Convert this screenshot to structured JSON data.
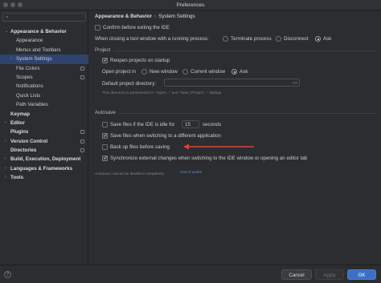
{
  "window": {
    "title": "Preferences"
  },
  "search": {
    "placeholder": "Q"
  },
  "sidebar": {
    "items": [
      {
        "label": "Appearance & Behavior",
        "arrow": "⌄",
        "bold": true,
        "indent": 0
      },
      {
        "label": "Appearance",
        "indent": 1
      },
      {
        "label": "Menus and Toolbars",
        "indent": 1
      },
      {
        "label": "System Settings",
        "arrow": "›",
        "indent": 1,
        "selected": true
      },
      {
        "label": "File Colors",
        "indent": 1,
        "mark": true
      },
      {
        "label": "Scopes",
        "indent": 1,
        "mark": true
      },
      {
        "label": "Notifications",
        "indent": 1
      },
      {
        "label": "Quick Lists",
        "indent": 1
      },
      {
        "label": "Path Variables",
        "indent": 1
      },
      {
        "label": "Keymap",
        "bold": true,
        "indent": 0
      },
      {
        "label": "Editor",
        "arrow": "›",
        "bold": true,
        "indent": 0
      },
      {
        "label": "Plugins",
        "bold": true,
        "indent": 0,
        "mark": true
      },
      {
        "label": "Version Control",
        "arrow": "›",
        "bold": true,
        "indent": 0,
        "mark": true
      },
      {
        "label": "Directories",
        "bold": true,
        "indent": 0,
        "mark": true
      },
      {
        "label": "Build, Execution, Deployment",
        "arrow": "›",
        "bold": true,
        "indent": 0
      },
      {
        "label": "Languages & Frameworks",
        "arrow": "›",
        "bold": true,
        "indent": 0
      },
      {
        "label": "Tools",
        "arrow": "›",
        "bold": true,
        "indent": 0
      }
    ]
  },
  "breadcrumb": {
    "parent": "Appearance & Behavior",
    "sep": "›",
    "page": "System Settings"
  },
  "general": {
    "confirm_exit": "Confirm before exiting the IDE",
    "closing_label": "When closing a tool window with a running process:",
    "closing_options": [
      "Terminate process",
      "Disconnect",
      "Ask"
    ],
    "closing_selected": "Ask"
  },
  "project": {
    "section": "Project",
    "reopen": "Reopen projects on startup",
    "open_label": "Open project in",
    "open_options": [
      "New window",
      "Current window",
      "Ask"
    ],
    "open_selected": "Ask",
    "default_dir_label": "Default project directory:",
    "default_dir_value": "",
    "default_dir_hint": "This directory is preselected in \"Open...\" and \"New | Project...\" dialogs."
  },
  "autosave": {
    "section": "Autosave",
    "idle_label": "Save files if the IDE is idle for",
    "idle_value": "15",
    "idle_unit": "seconds",
    "switch_app": "Save files when switching to a different application",
    "backup": "Back up files before saving",
    "sync": "Synchronize external changes when switching to the IDE window or opening an editor tab",
    "note": "Autosave cannot be disabled completely.",
    "link": "How it works"
  },
  "footer": {
    "help": "?",
    "cancel": "Cancel",
    "apply": "Apply",
    "ok": "OK"
  },
  "colors": {
    "selection": "#2e436e",
    "accent": "#3b6fc4",
    "annotation_arrow": "#d9433a"
  }
}
